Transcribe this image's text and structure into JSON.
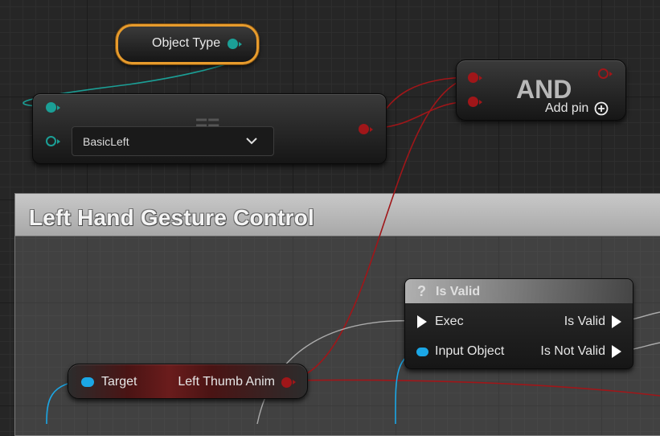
{
  "object_type_node": {
    "label": "Object Type"
  },
  "equals_node": {
    "dropdown_value": "BasicLeft",
    "compare_glyph": "=="
  },
  "and_node": {
    "title": "AND",
    "add_pin_label": "Add pin"
  },
  "comment": {
    "title": "Left Hand Gesture Control"
  },
  "is_valid_node": {
    "title": "Is Valid",
    "title_icon": "?",
    "pins": {
      "exec": "Exec",
      "input_object": "Input Object",
      "is_valid": "Is Valid",
      "is_not_valid": "Is Not Valid"
    }
  },
  "getter_node": {
    "target_label": "Target",
    "output_label": "Left Thumb Anim"
  },
  "colors": {
    "object_pin": "#1b9f96",
    "bool_pin": "#a01619",
    "object_ref_pin": "#1ba7e6",
    "exec": "#ffffff",
    "selection": "#e79b2c"
  }
}
